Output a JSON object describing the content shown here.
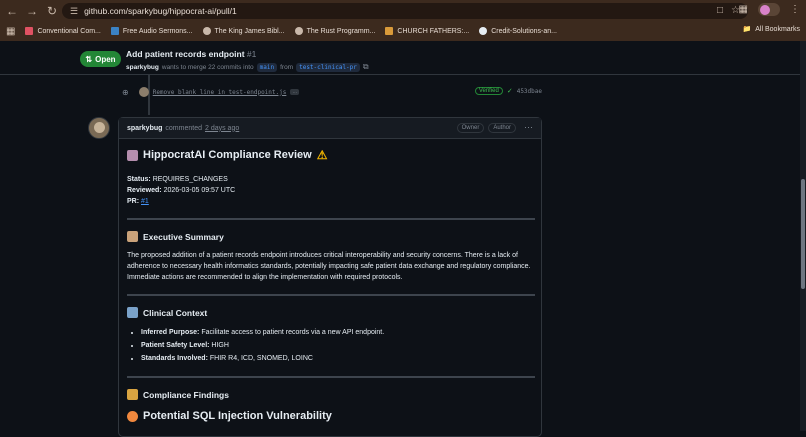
{
  "browser": {
    "url": "github.com/sparkybug/hippocrat-ai/pull/1",
    "bookmarks": [
      {
        "label": "Conventional Com...",
        "color": "#e05263"
      },
      {
        "label": "Free Audio Sermons...",
        "color": "#3b82c4"
      },
      {
        "label": "The King James Bibl...",
        "color": "#c9b8aa"
      },
      {
        "label": "The Rust Programm...",
        "color": "#c9b8aa"
      },
      {
        "label": "CHURCH FATHERS:...",
        "color": "#d99a3a"
      },
      {
        "label": "Credit-Solutions-an...",
        "color": "#e6edf3"
      }
    ],
    "all_bookmarks": "All Bookmarks"
  },
  "pr": {
    "status": "Open",
    "title": "Add patient records endpoint",
    "number": "#1",
    "author": "sparkybug",
    "merge_text": "wants to merge 22 commits into",
    "base_branch": "main",
    "from_text": "from",
    "head_branch": "test-clinical-pr"
  },
  "commit": {
    "message": "Remove blank line in test-endpoint.js",
    "ellipsis": "…",
    "verified": "Verified",
    "sha": "453dbae"
  },
  "comment": {
    "author": "sparkybug",
    "action": "commented",
    "time": "2 days ago",
    "badge_owner": "Owner",
    "badge_author": "Author",
    "title": "HippocratAI Compliance Review",
    "status_label": "Status:",
    "status_value": "REQUIRES_CHANGES",
    "reviewed_label": "Reviewed:",
    "reviewed_value": "2026-03-05 09:57 UTC",
    "pr_label": "PR:",
    "pr_value": "#1",
    "exec_title": "Executive Summary",
    "exec_body": "The proposed addition of a patient records endpoint introduces critical interoperability and security concerns. There is a lack of adherence to necessary health informatics standards, potentially impacting safe patient data exchange and regulatory compliance. Immediate actions are recommended to align the implementation with required protocols.",
    "clinical_title": "Clinical Context",
    "clinical_items": [
      {
        "label": "Inferred Purpose:",
        "value": "Facilitate access to patient records via a new API endpoint."
      },
      {
        "label": "Patient Safety Level:",
        "value": "HIGH"
      },
      {
        "label": "Standards Involved:",
        "value": "FHIR R4, ICD, SNOMED, LOINC"
      }
    ],
    "findings_title": "Compliance Findings",
    "finding_1_title": "Potential SQL Injection Vulnerability"
  }
}
